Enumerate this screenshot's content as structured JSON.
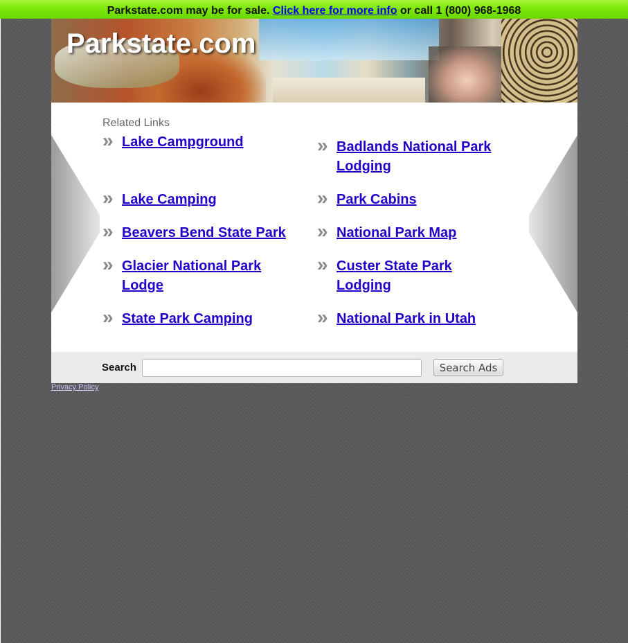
{
  "sale_bar": {
    "prefix": "Parkstate.com may be for sale.",
    "link_text": "Click here for more info",
    "suffix": "or call 1 (800) 968-1968"
  },
  "site": {
    "title": "Parkstate.com"
  },
  "related": {
    "heading": "Related Links",
    "links": [
      {
        "label": "Lake Campground",
        "icon": "double-chevron-right-icon"
      },
      {
        "label": "Badlands National Park Lodging",
        "icon": "double-chevron-right-icon"
      },
      {
        "label": "Lake Camping",
        "icon": "double-chevron-right-icon"
      },
      {
        "label": "Park Cabins",
        "icon": "double-chevron-right-icon"
      },
      {
        "label": "Beavers Bend State Park",
        "icon": "double-chevron-right-icon"
      },
      {
        "label": "National Park Map",
        "icon": "double-chevron-right-icon"
      },
      {
        "label": "Glacier National Park Lodge",
        "icon": "double-chevron-right-icon"
      },
      {
        "label": "Custer State Park Lodging",
        "icon": "double-chevron-right-icon"
      },
      {
        "label": "State Park Camping",
        "icon": "double-chevron-right-icon"
      },
      {
        "label": "National Park in Utah",
        "icon": "double-chevron-right-icon"
      }
    ]
  },
  "search": {
    "label": "Search",
    "value": "",
    "button_label": "Search Ads"
  },
  "footer": {
    "privacy_label": "Privacy Policy"
  },
  "colors": {
    "sale_bar": "#7ee80a",
    "link": "#2400c8",
    "background": "#5a5a5a"
  }
}
